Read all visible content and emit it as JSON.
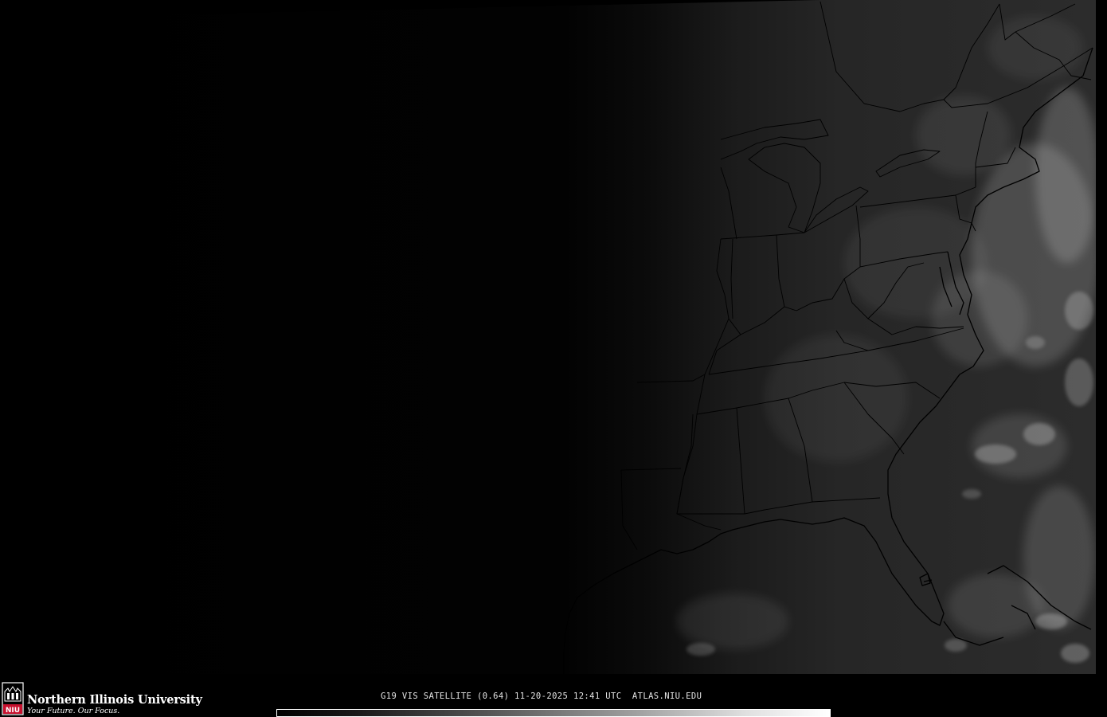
{
  "image": {
    "caption": "G19 VIS SATELLITE (0.64) 11-20-2025 12:41 UTC  ATLAS.NIU.EDU",
    "product": "VIS",
    "band_wavelength_um": 0.64,
    "date": "11-20-2025",
    "time_utc": "12:41",
    "site": "ATLAS.NIU.EDU"
  },
  "branding": {
    "name": "Northern Illinois University",
    "tagline": "Your Future. Our Focus.",
    "seal_text": "NIU"
  },
  "colors": {
    "background": "#000000",
    "land_day": "#2b2b2b",
    "boundary": "#000000",
    "cloud": "#ffffff",
    "seal_red": "#c8102e"
  },
  "map": {
    "region": "Eastern United States",
    "lighting": "terminator with night on the west and daylight on the east"
  }
}
